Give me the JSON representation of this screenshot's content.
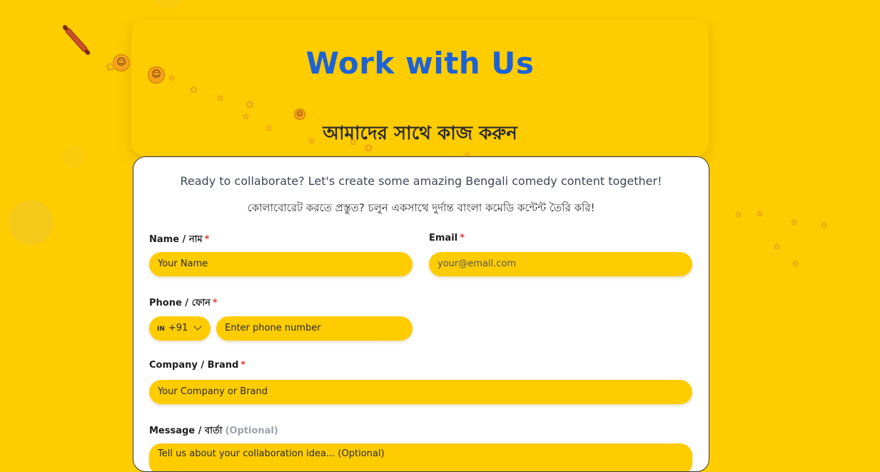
{
  "header": {
    "title": "Work with Us",
    "title_bn": "আমাদের সাথে কাজ করুন"
  },
  "form": {
    "intro": "Ready to collaborate? Let's create some amazing Bengali comedy content together!",
    "intro_bn": "কোলাবোরেট করতে প্রস্তুত? চলুন একসাথে দুর্দান্ত বাংলা কমেডি কন্টেন্ট তৈরি করি!",
    "name": {
      "label": "Name / নাম",
      "required": "*",
      "placeholder": "Your Name"
    },
    "email": {
      "label": "Email",
      "required": "*",
      "placeholder": "your@email.com"
    },
    "phone": {
      "label": "Phone / ফোন",
      "required": "*",
      "country_flag": "IN",
      "country_code": "+91",
      "placeholder": "Enter phone number"
    },
    "company": {
      "label": "Company / Brand",
      "required": "*",
      "placeholder": "Your Company or Brand"
    },
    "message": {
      "label": "Message / বার্তা",
      "optional": "(Optional)",
      "placeholder": "Tell us about your collaboration idea... (Optional)"
    }
  },
  "colors": {
    "background": "#FFCC00",
    "title": "#1D62D5",
    "required": "#e03a3a",
    "field_bg": "#FFCC00"
  },
  "decorations": {
    "emoji_icons": [
      "laughing-face-icon",
      "laughing-face-icon",
      "laughing-face-icon",
      "laughing-face-icon"
    ],
    "rolling_pin_icon": "rolling-pin-icon",
    "leaf_icons": "maple-leaf-icon"
  }
}
